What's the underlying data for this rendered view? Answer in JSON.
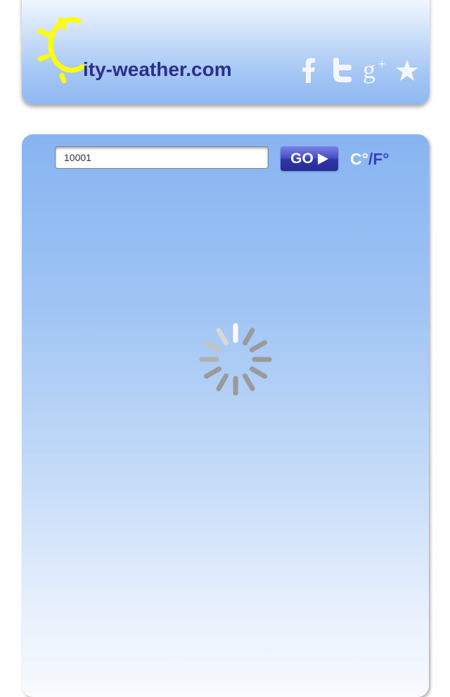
{
  "header": {
    "site_name": "ity-weather.com",
    "logo_letter": "C",
    "social_icons": [
      "facebook-icon",
      "twitter-icon",
      "google-plus-icon",
      "star-icon"
    ]
  },
  "search": {
    "value": "10001"
  },
  "go_button": {
    "label": "GO"
  },
  "units": {
    "celsius": "C°",
    "separator": "/",
    "fahrenheit": "F°"
  },
  "status": {
    "loading_icon": "loading-spinner-icon"
  },
  "colors": {
    "brand_text": "#2a2f8f",
    "sun_yellow": "#ffff00",
    "go_button": "#3a41b8",
    "panel_top": "#87b4f1",
    "panel_bottom": "#f8fbff"
  }
}
